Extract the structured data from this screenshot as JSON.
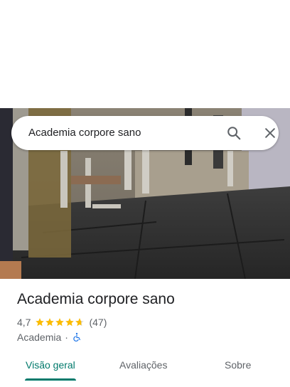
{
  "search": {
    "query": "Academia corpore sano"
  },
  "place": {
    "name": "Academia corpore sano",
    "rating": "4,7",
    "stars_value": 4.7,
    "stars_max": 5,
    "review_count": "(47)",
    "category": "Academia",
    "separator": "·",
    "accessible": true
  },
  "tabs": [
    {
      "label": "Visão geral",
      "active": true
    },
    {
      "label": "Avaliações",
      "active": false
    },
    {
      "label": "Sobre",
      "active": false
    }
  ],
  "colors": {
    "accent": "#00796b",
    "star": "#fbbc04",
    "accessibility": "#1a73e8"
  },
  "icons": {
    "search": "search-icon",
    "close": "close-icon",
    "star": "star-icon",
    "accessibility": "wheelchair-icon"
  }
}
